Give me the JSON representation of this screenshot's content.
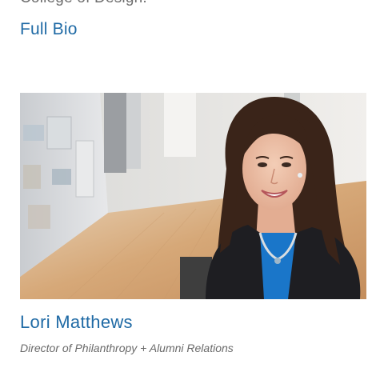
{
  "intro": {
    "cut_text": "College of Design."
  },
  "bio_link": {
    "label": "Full Bio"
  },
  "profile": {
    "photo_icon": "portrait-photo",
    "name": "Lori Matthews",
    "title": "Director of Philanthropy + Alumni Relations"
  },
  "colors": {
    "link": "#1f6aa5",
    "muted_text": "#6a6a6a",
    "blouse": "#1a76c9"
  }
}
